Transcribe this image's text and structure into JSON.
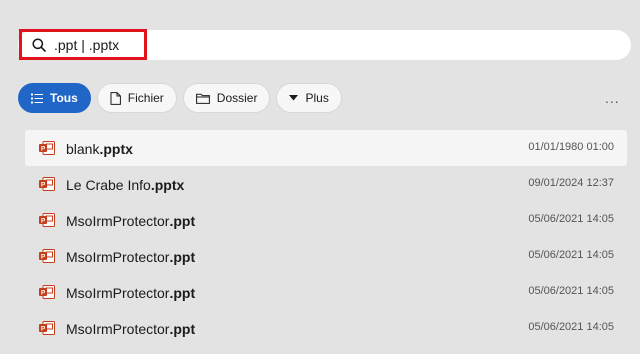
{
  "search": {
    "query": ".ppt | .pptx"
  },
  "filters": [
    {
      "label": "Tous",
      "active": true,
      "icon": "list-icon"
    },
    {
      "label": "Fichier",
      "active": false,
      "icon": "file-icon"
    },
    {
      "label": "Dossier",
      "active": false,
      "icon": "folder-icon"
    },
    {
      "label": "Plus",
      "active": false,
      "icon": "caret-down-icon"
    }
  ],
  "overflow_label": "...",
  "results": [
    {
      "name_base": "blank",
      "name_ext": ".pptx",
      "date": "01/01/1980 01:00",
      "selected": true
    },
    {
      "name_base": "Le Crabe Info",
      "name_ext": ".pptx",
      "date": "09/01/2024 12:37",
      "selected": false
    },
    {
      "name_base": "MsoIrmProtector",
      "name_ext": ".ppt",
      "date": "05/06/2021 14:05",
      "selected": false
    },
    {
      "name_base": "MsoIrmProtector",
      "name_ext": ".ppt",
      "date": "05/06/2021 14:05",
      "selected": false
    },
    {
      "name_base": "MsoIrmProtector",
      "name_ext": ".ppt",
      "date": "05/06/2021 14:05",
      "selected": false
    },
    {
      "name_base": "MsoIrmProtector",
      "name_ext": ".ppt",
      "date": "05/06/2021 14:05",
      "selected": false
    }
  ],
  "colors": {
    "accent": "#1f66c7",
    "highlight": "#e0141b",
    "ppt_icon": "#c43e1c"
  }
}
